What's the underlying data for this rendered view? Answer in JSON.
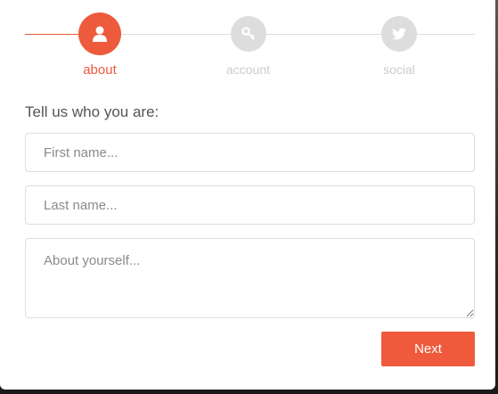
{
  "steps": [
    {
      "label": "about",
      "icon": "user-icon",
      "state": "active"
    },
    {
      "label": "account",
      "icon": "key-icon",
      "state": "inactive"
    },
    {
      "label": "social",
      "icon": "twitter-icon",
      "state": "inactive"
    }
  ],
  "form": {
    "prompt": "Tell us who you are:",
    "first_name_placeholder": "First name...",
    "last_name_placeholder": "Last name...",
    "about_placeholder": "About yourself..."
  },
  "actions": {
    "next_label": "Next"
  },
  "colors": {
    "accent": "#ee5a3c",
    "inactive": "#dddddd"
  }
}
